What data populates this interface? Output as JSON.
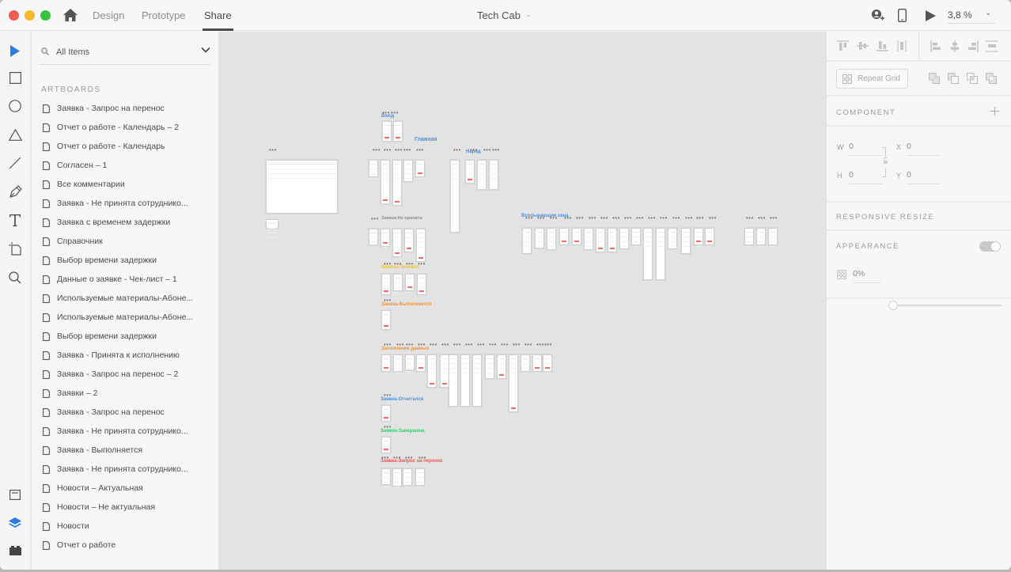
{
  "titlebar": {
    "tabs": [
      {
        "label": "Design",
        "active": false
      },
      {
        "label": "Prototype",
        "active": false
      },
      {
        "label": "Share",
        "active": true
      }
    ],
    "document_title": "Tech Cab",
    "zoom_level": "3,8 %",
    "icons": [
      "home-icon",
      "share-user-icon",
      "device-preview-icon",
      "play-icon"
    ]
  },
  "toolbar": {
    "tools": [
      "select-tool",
      "rectangle-tool",
      "ellipse-tool",
      "polygon-tool",
      "line-tool",
      "pen-tool",
      "text-tool",
      "artboard-tool",
      "zoom-tool"
    ],
    "bottom_tools": [
      "assets-panel",
      "layers-panel",
      "plugins-panel"
    ],
    "active_panel": "layers-panel",
    "accent_color": "#2d7be5"
  },
  "layers_panel": {
    "filter": "All Items",
    "section_title": "ARTBOARDS",
    "artboards": [
      "Заявка - Запрос на перенос",
      "Отчет о работе - Календарь – 2",
      "Отчет о работе - Календарь",
      "Согласен – 1",
      "Все комментарии",
      "Заявка - Не принята сотруднико...",
      "Заявка с временем задержки",
      "Справочник",
      "Выбор времени задержки",
      "Данные о заявке - Чек-лист – 1",
      "Используемые материалы-Абоне...",
      "Используемые материалы-Абоне...",
      "Выбор времени задержки",
      "Заявка - Принята к исполнению",
      "Заявка - Запрос на перенос – 2",
      "Заявки – 2",
      "Заявка - Запрос на перенос",
      "Заявка - Не принята сотруднико...",
      "Заявка - Выполняется",
      "Заявка - Не принята сотруднико...",
      "Новости – Актуальная",
      "Новости – Не актуальная",
      "Новости",
      "Отчет о работе"
    ]
  },
  "canvas": {
    "group_labels": [
      {
        "text": "Вход",
        "color": "#4a90e2"
      },
      {
        "text": "Главная",
        "color": "#4a90e2"
      },
      {
        "text": "Наряд",
        "color": "#4a90e2"
      },
      {
        "text": "Заявка-Не принята",
        "color": "#9b9b9b"
      },
      {
        "text": "Всплывающие окна",
        "color": "#4a90e2"
      },
      {
        "text": "Заявка-Принята",
        "color": "#f5c523"
      },
      {
        "text": "Заявка-Выполняется",
        "color": "#f5922f"
      },
      {
        "text": "Заполнение данных",
        "color": "#f5922f"
      },
      {
        "text": "Заявка-Отчитался",
        "color": "#4a90e2"
      },
      {
        "text": "Заявка-Завершена",
        "color": "#2ecc71"
      },
      {
        "text": "Заявка-Запрос на перенос",
        "color": "#f05454"
      }
    ]
  },
  "inspector": {
    "repeat_grid_label": "Repeat Grid",
    "component_title": "COMPONENT",
    "w_label": "W",
    "w_value": "0",
    "h_label": "H",
    "h_value": "0",
    "x_label": "X",
    "x_value": "0",
    "y_label": "Y",
    "y_value": "0",
    "responsive_title": "RESPONSIVE RESIZE",
    "responsive_on": true,
    "appearance_title": "APPEARANCE",
    "opacity_value": "0%",
    "opacity_fraction": 0.0
  }
}
